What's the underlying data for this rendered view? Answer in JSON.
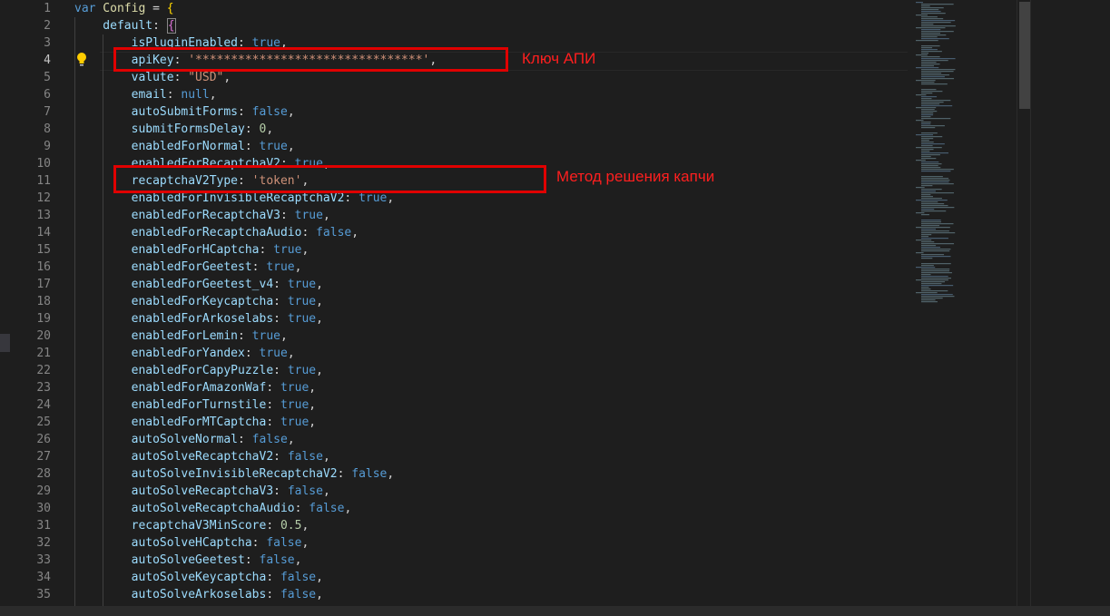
{
  "editor": {
    "lines": [
      [
        [
          "kw",
          "var"
        ],
        [
          "def",
          " Config"
        ],
        [
          "pun",
          " = "
        ],
        [
          "brace1",
          "{"
        ]
      ],
      [
        [
          "prop",
          "    default"
        ],
        [
          "pun",
          ": "
        ],
        [
          "brace2",
          "{"
        ]
      ],
      [
        [
          "prop",
          "        isPluginEnabled"
        ],
        [
          "pun",
          ": "
        ],
        [
          "kw",
          "true"
        ],
        [
          "pun",
          ","
        ]
      ],
      [
        [
          "prop",
          "        apiKey"
        ],
        [
          "pun",
          ": "
        ],
        [
          "str",
          "'********************************'"
        ],
        [
          "pun",
          ","
        ]
      ],
      [
        [
          "prop",
          "        valute"
        ],
        [
          "pun",
          ": "
        ],
        [
          "str",
          "\"USD\""
        ],
        [
          "pun",
          ","
        ]
      ],
      [
        [
          "prop",
          "        email"
        ],
        [
          "pun",
          ": "
        ],
        [
          "kw",
          "null"
        ],
        [
          "pun",
          ","
        ]
      ],
      [
        [
          "prop",
          "        autoSubmitForms"
        ],
        [
          "pun",
          ": "
        ],
        [
          "kw",
          "false"
        ],
        [
          "pun",
          ","
        ]
      ],
      [
        [
          "prop",
          "        submitFormsDelay"
        ],
        [
          "pun",
          ": "
        ],
        [
          "num",
          "0"
        ],
        [
          "pun",
          ","
        ]
      ],
      [
        [
          "prop",
          "        enabledForNormal"
        ],
        [
          "pun",
          ": "
        ],
        [
          "kw",
          "true"
        ],
        [
          "pun",
          ","
        ]
      ],
      [
        [
          "prop",
          "        enabledForRecaptchaV2"
        ],
        [
          "pun",
          ": "
        ],
        [
          "kw",
          "true"
        ],
        [
          "pun",
          ","
        ]
      ],
      [
        [
          "prop",
          "        recaptchaV2Type"
        ],
        [
          "pun",
          ": "
        ],
        [
          "str",
          "'token'"
        ],
        [
          "pun",
          ","
        ]
      ],
      [
        [
          "prop",
          "        enabledForInvisibleRecaptchaV2"
        ],
        [
          "pun",
          ": "
        ],
        [
          "kw",
          "true"
        ],
        [
          "pun",
          ","
        ]
      ],
      [
        [
          "prop",
          "        enabledForRecaptchaV3"
        ],
        [
          "pun",
          ": "
        ],
        [
          "kw",
          "true"
        ],
        [
          "pun",
          ","
        ]
      ],
      [
        [
          "prop",
          "        enabledForRecaptchaAudio"
        ],
        [
          "pun",
          ": "
        ],
        [
          "kw",
          "false"
        ],
        [
          "pun",
          ","
        ]
      ],
      [
        [
          "prop",
          "        enabledForHCaptcha"
        ],
        [
          "pun",
          ": "
        ],
        [
          "kw",
          "true"
        ],
        [
          "pun",
          ","
        ]
      ],
      [
        [
          "prop",
          "        enabledForGeetest"
        ],
        [
          "pun",
          ": "
        ],
        [
          "kw",
          "true"
        ],
        [
          "pun",
          ","
        ]
      ],
      [
        [
          "prop",
          "        enabledForGeetest_v4"
        ],
        [
          "pun",
          ": "
        ],
        [
          "kw",
          "true"
        ],
        [
          "pun",
          ","
        ]
      ],
      [
        [
          "prop",
          "        enabledForKeycaptcha"
        ],
        [
          "pun",
          ": "
        ],
        [
          "kw",
          "true"
        ],
        [
          "pun",
          ","
        ]
      ],
      [
        [
          "prop",
          "        enabledForArkoselabs"
        ],
        [
          "pun",
          ": "
        ],
        [
          "kw",
          "true"
        ],
        [
          "pun",
          ","
        ]
      ],
      [
        [
          "prop",
          "        enabledForLemin"
        ],
        [
          "pun",
          ": "
        ],
        [
          "kw",
          "true"
        ],
        [
          "pun",
          ","
        ]
      ],
      [
        [
          "prop",
          "        enabledForYandex"
        ],
        [
          "pun",
          ": "
        ],
        [
          "kw",
          "true"
        ],
        [
          "pun",
          ","
        ]
      ],
      [
        [
          "prop",
          "        enabledForCapyPuzzle"
        ],
        [
          "pun",
          ": "
        ],
        [
          "kw",
          "true"
        ],
        [
          "pun",
          ","
        ]
      ],
      [
        [
          "prop",
          "        enabledForAmazonWaf"
        ],
        [
          "pun",
          ": "
        ],
        [
          "kw",
          "true"
        ],
        [
          "pun",
          ","
        ]
      ],
      [
        [
          "prop",
          "        enabledForTurnstile"
        ],
        [
          "pun",
          ": "
        ],
        [
          "kw",
          "true"
        ],
        [
          "pun",
          ","
        ]
      ],
      [
        [
          "prop",
          "        enabledForMTCaptcha"
        ],
        [
          "pun",
          ": "
        ],
        [
          "kw",
          "true"
        ],
        [
          "pun",
          ","
        ]
      ],
      [
        [
          "prop",
          "        autoSolveNormal"
        ],
        [
          "pun",
          ": "
        ],
        [
          "kw",
          "false"
        ],
        [
          "pun",
          ","
        ]
      ],
      [
        [
          "prop",
          "        autoSolveRecaptchaV2"
        ],
        [
          "pun",
          ": "
        ],
        [
          "kw",
          "false"
        ],
        [
          "pun",
          ","
        ]
      ],
      [
        [
          "prop",
          "        autoSolveInvisibleRecaptchaV2"
        ],
        [
          "pun",
          ": "
        ],
        [
          "kw",
          "false"
        ],
        [
          "pun",
          ","
        ]
      ],
      [
        [
          "prop",
          "        autoSolveRecaptchaV3"
        ],
        [
          "pun",
          ": "
        ],
        [
          "kw",
          "false"
        ],
        [
          "pun",
          ","
        ]
      ],
      [
        [
          "prop",
          "        autoSolveRecaptchaAudio"
        ],
        [
          "pun",
          ": "
        ],
        [
          "kw",
          "false"
        ],
        [
          "pun",
          ","
        ]
      ],
      [
        [
          "prop",
          "        recaptchaV3MinScore"
        ],
        [
          "pun",
          ": "
        ],
        [
          "num",
          "0.5"
        ],
        [
          "pun",
          ","
        ]
      ],
      [
        [
          "prop",
          "        autoSolveHCaptcha"
        ],
        [
          "pun",
          ": "
        ],
        [
          "kw",
          "false"
        ],
        [
          "pun",
          ","
        ]
      ],
      [
        [
          "prop",
          "        autoSolveGeetest"
        ],
        [
          "pun",
          ": "
        ],
        [
          "kw",
          "false"
        ],
        [
          "pun",
          ","
        ]
      ],
      [
        [
          "prop",
          "        autoSolveKeycaptcha"
        ],
        [
          "pun",
          ": "
        ],
        [
          "kw",
          "false"
        ],
        [
          "pun",
          ","
        ]
      ],
      [
        [
          "prop",
          "        autoSolveArkoselabs"
        ],
        [
          "pun",
          ": "
        ],
        [
          "kw",
          "false"
        ],
        [
          "pun",
          ","
        ]
      ]
    ],
    "active_line": 4
  },
  "annotations": {
    "api_key_label": "Ключ АПИ",
    "captcha_method_label": "Метод решения капчи",
    "box_color": "#e00000",
    "text_color": "#ff1f1f"
  },
  "theme": {
    "background": "#1e1e1e",
    "keyword": "#569cd6",
    "property": "#9cdcfe",
    "string": "#ce9178",
    "number": "#b5cea8"
  },
  "icons": [
    "lightbulb-icon"
  ]
}
